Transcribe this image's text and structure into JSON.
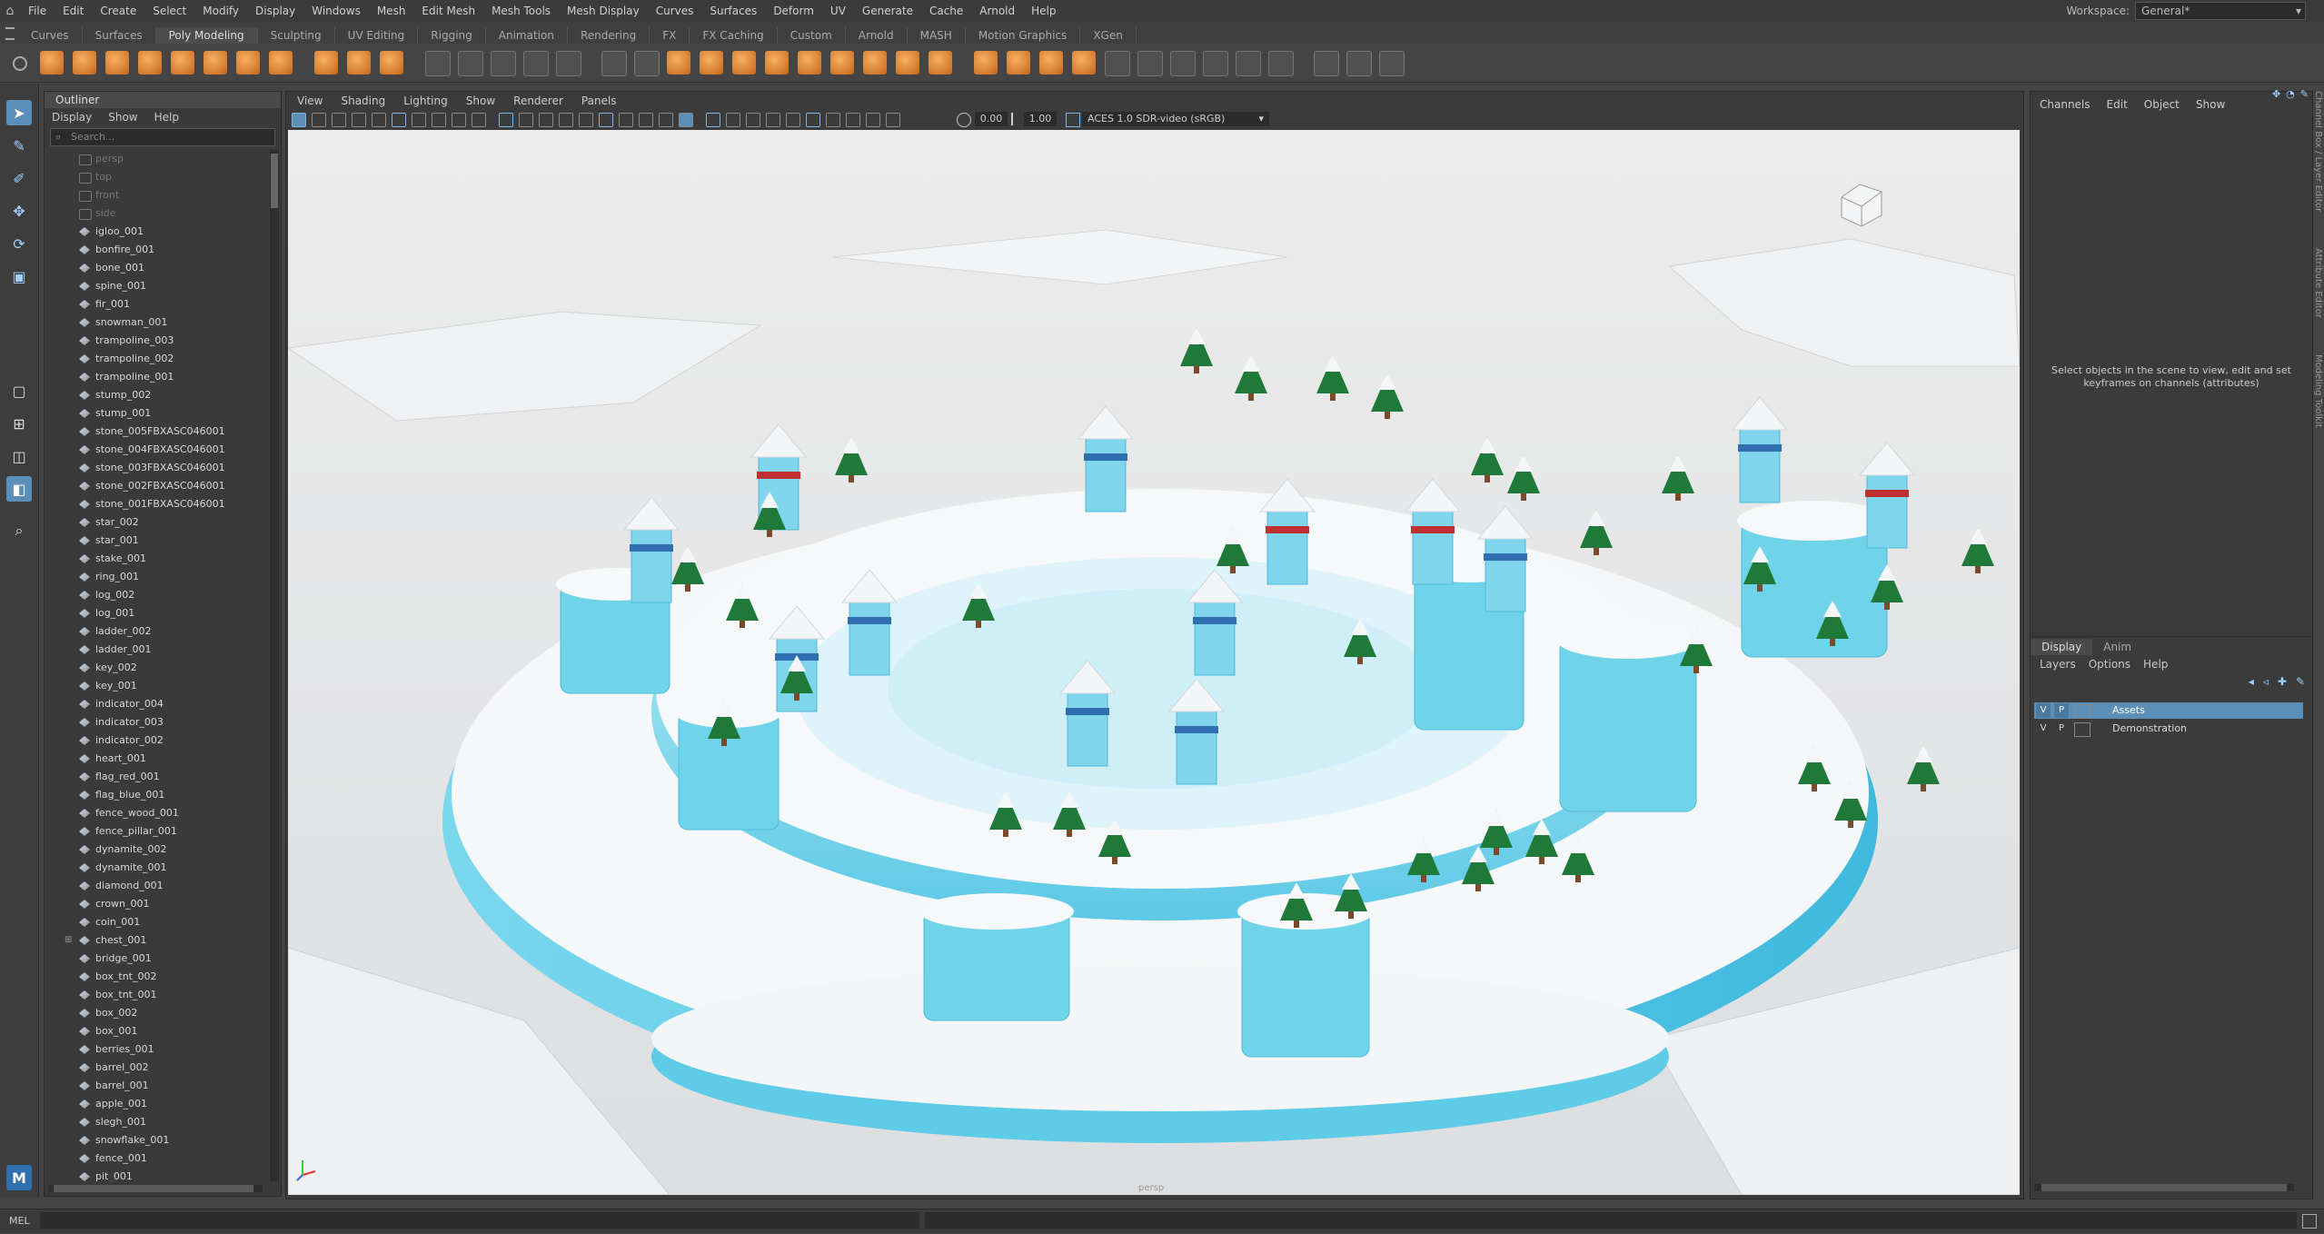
{
  "menubar": {
    "items": [
      "File",
      "Edit",
      "Create",
      "Select",
      "Modify",
      "Display",
      "Windows",
      "Mesh",
      "Edit Mesh",
      "Mesh Tools",
      "Mesh Display",
      "Curves",
      "Surfaces",
      "Deform",
      "UV",
      "Generate",
      "Cache",
      "Arnold",
      "Help"
    ],
    "workspace_label": "Workspace:",
    "workspace_value": "General*"
  },
  "shelf_tabs": {
    "items": [
      "Curves",
      "Surfaces",
      "Poly Modeling",
      "Sculpting",
      "UV Editing",
      "Rigging",
      "Animation",
      "Rendering",
      "FX",
      "FX Caching",
      "Custom",
      "Arnold",
      "MASH",
      "Motion Graphics",
      "XGen"
    ],
    "active": "Poly Modeling"
  },
  "outliner": {
    "title": "Outliner",
    "menus": [
      "Display",
      "Show",
      "Help"
    ],
    "search_placeholder": "Search...",
    "items": [
      {
        "name": "persp",
        "type": "camera"
      },
      {
        "name": "top",
        "type": "camera"
      },
      {
        "name": "front",
        "type": "camera"
      },
      {
        "name": "side",
        "type": "camera"
      },
      {
        "name": "igloo_001",
        "type": "mesh"
      },
      {
        "name": "bonfire_001",
        "type": "mesh"
      },
      {
        "name": "bone_001",
        "type": "mesh"
      },
      {
        "name": "spine_001",
        "type": "mesh"
      },
      {
        "name": "fir_001",
        "type": "mesh"
      },
      {
        "name": "snowman_001",
        "type": "mesh"
      },
      {
        "name": "trampoline_003",
        "type": "mesh"
      },
      {
        "name": "trampoline_002",
        "type": "mesh"
      },
      {
        "name": "trampoline_001",
        "type": "mesh"
      },
      {
        "name": "stump_002",
        "type": "mesh"
      },
      {
        "name": "stump_001",
        "type": "mesh"
      },
      {
        "name": "stone_005FBXASC046001",
        "type": "mesh"
      },
      {
        "name": "stone_004FBXASC046001",
        "type": "mesh"
      },
      {
        "name": "stone_003FBXASC046001",
        "type": "mesh"
      },
      {
        "name": "stone_002FBXASC046001",
        "type": "mesh"
      },
      {
        "name": "stone_001FBXASC046001",
        "type": "mesh"
      },
      {
        "name": "star_002",
        "type": "mesh"
      },
      {
        "name": "star_001",
        "type": "mesh"
      },
      {
        "name": "stake_001",
        "type": "mesh"
      },
      {
        "name": "ring_001",
        "type": "mesh"
      },
      {
        "name": "log_002",
        "type": "mesh"
      },
      {
        "name": "log_001",
        "type": "mesh"
      },
      {
        "name": "ladder_002",
        "type": "mesh"
      },
      {
        "name": "ladder_001",
        "type": "mesh"
      },
      {
        "name": "key_002",
        "type": "mesh"
      },
      {
        "name": "key_001",
        "type": "mesh"
      },
      {
        "name": "indicator_004",
        "type": "mesh"
      },
      {
        "name": "indicator_003",
        "type": "mesh"
      },
      {
        "name": "indicator_002",
        "type": "mesh"
      },
      {
        "name": "heart_001",
        "type": "mesh"
      },
      {
        "name": "flag_red_001",
        "type": "mesh"
      },
      {
        "name": "flag_blue_001",
        "type": "mesh"
      },
      {
        "name": "fence_wood_001",
        "type": "mesh"
      },
      {
        "name": "fence_pillar_001",
        "type": "mesh"
      },
      {
        "name": "dynamite_002",
        "type": "mesh"
      },
      {
        "name": "dynamite_001",
        "type": "mesh"
      },
      {
        "name": "diamond_001",
        "type": "mesh"
      },
      {
        "name": "crown_001",
        "type": "mesh"
      },
      {
        "name": "coin_001",
        "type": "mesh"
      },
      {
        "name": "chest_001",
        "type": "group"
      },
      {
        "name": "bridge_001",
        "type": "mesh"
      },
      {
        "name": "box_tnt_002",
        "type": "mesh"
      },
      {
        "name": "box_tnt_001",
        "type": "mesh"
      },
      {
        "name": "box_002",
        "type": "mesh"
      },
      {
        "name": "box_001",
        "type": "mesh"
      },
      {
        "name": "berries_001",
        "type": "mesh"
      },
      {
        "name": "barrel_002",
        "type": "mesh"
      },
      {
        "name": "barrel_001",
        "type": "mesh"
      },
      {
        "name": "apple_001",
        "type": "mesh"
      },
      {
        "name": "slegh_001",
        "type": "mesh"
      },
      {
        "name": "snowflake_001",
        "type": "mesh"
      },
      {
        "name": "fence_001",
        "type": "mesh"
      },
      {
        "name": "pit_001",
        "type": "mesh"
      }
    ]
  },
  "viewport": {
    "menus": [
      "View",
      "Shading",
      "Lighting",
      "Show",
      "Renderer",
      "Panels"
    ],
    "field1": "0.00",
    "field2": "1.00",
    "colorspace": "ACES 1.0 SDR-video (sRGB)",
    "camera_label": "persp"
  },
  "channel_box": {
    "menus": [
      "Channels",
      "Edit",
      "Object",
      "Show"
    ],
    "message": "Select objects in the scene to view, edit and set keyframes on channels (attributes)"
  },
  "layer_editor": {
    "tabs": [
      "Display",
      "Anim"
    ],
    "menus": [
      "Layers",
      "Options",
      "Help"
    ],
    "layers": [
      {
        "v": "V",
        "p": "P",
        "name": "Assets",
        "selected": true
      },
      {
        "v": "V",
        "p": "P",
        "name": "Demonstration",
        "selected": false
      }
    ]
  },
  "side_tabs": [
    "Channel Box / Layer Editor",
    "Attribute Editor",
    "Modeling Toolkit"
  ],
  "cmdline": {
    "label": "MEL"
  },
  "colors": {
    "accent": "#5c8fb8",
    "ice": "#6fd3ea",
    "snow": "#f4f5f6",
    "orange_icon": "#e08a2c"
  }
}
